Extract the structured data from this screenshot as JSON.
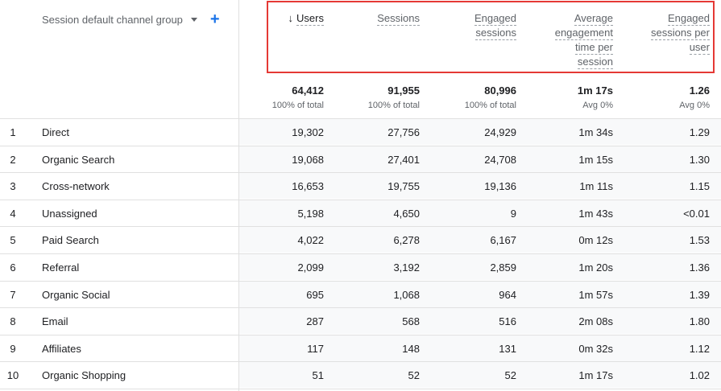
{
  "header": {
    "dimension_label": "Session default channel group",
    "columns": [
      {
        "lines": [
          "Users"
        ],
        "sorted": true
      },
      {
        "lines": [
          "Sessions"
        ],
        "sorted": false
      },
      {
        "lines": [
          "Engaged",
          "sessions"
        ],
        "sorted": false
      },
      {
        "lines": [
          "Average",
          "engagement",
          "time per",
          "session"
        ],
        "sorted": false
      },
      {
        "lines": [
          "Engaged",
          "sessions per",
          "user"
        ],
        "sorted": false
      }
    ],
    "sort_arrow": "↓",
    "add_icon": "+"
  },
  "totals": {
    "values": [
      "64,412",
      "91,955",
      "80,996",
      "1m 17s",
      "1.26"
    ],
    "subs": [
      "100% of total",
      "100% of total",
      "100% of total",
      "Avg 0%",
      "Avg 0%"
    ]
  },
  "rows": [
    {
      "idx": "1",
      "name": "Direct",
      "cells": [
        "19,302",
        "27,756",
        "24,929",
        "1m 34s",
        "1.29"
      ]
    },
    {
      "idx": "2",
      "name": "Organic Search",
      "cells": [
        "19,068",
        "27,401",
        "24,708",
        "1m 15s",
        "1.30"
      ]
    },
    {
      "idx": "3",
      "name": "Cross-network",
      "cells": [
        "16,653",
        "19,755",
        "19,136",
        "1m 11s",
        "1.15"
      ]
    },
    {
      "idx": "4",
      "name": "Unassigned",
      "cells": [
        "5,198",
        "4,650",
        "9",
        "1m 43s",
        "<0.01"
      ]
    },
    {
      "idx": "5",
      "name": "Paid Search",
      "cells": [
        "4,022",
        "6,278",
        "6,167",
        "0m 12s",
        "1.53"
      ]
    },
    {
      "idx": "6",
      "name": "Referral",
      "cells": [
        "2,099",
        "3,192",
        "2,859",
        "1m 20s",
        "1.36"
      ]
    },
    {
      "idx": "7",
      "name": "Organic Social",
      "cells": [
        "695",
        "1,068",
        "964",
        "1m 57s",
        "1.39"
      ]
    },
    {
      "idx": "8",
      "name": "Email",
      "cells": [
        "287",
        "568",
        "516",
        "2m 08s",
        "1.80"
      ]
    },
    {
      "idx": "9",
      "name": "Affiliates",
      "cells": [
        "117",
        "148",
        "131",
        "0m 32s",
        "1.12"
      ]
    },
    {
      "idx": "10",
      "name": "Organic Shopping",
      "cells": [
        "51",
        "52",
        "52",
        "1m 17s",
        "1.02"
      ]
    }
  ],
  "colors": {
    "highlight": "#e53935",
    "accent": "#1a73e8"
  }
}
